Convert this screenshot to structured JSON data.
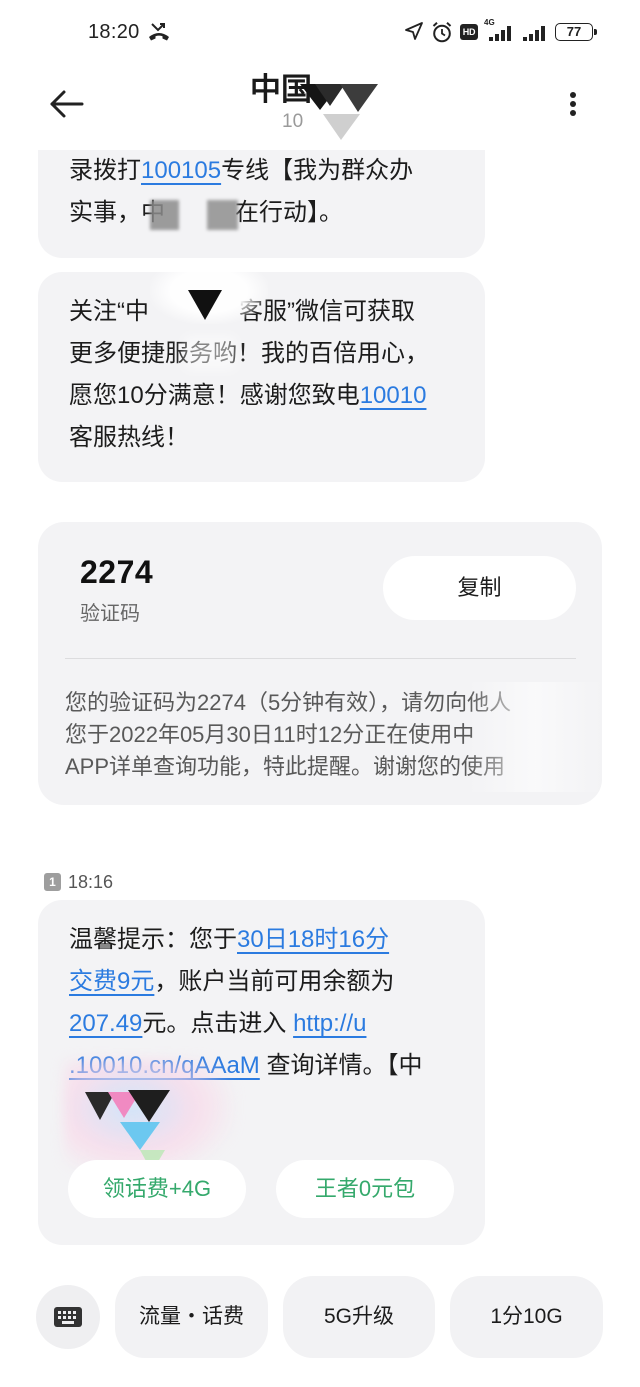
{
  "colors": {
    "link": "#2b7be0",
    "action_green": "#35a96c",
    "bubble_bg": "#f3f3f5",
    "text": "#1c1c1c"
  },
  "status_bar": {
    "time": "18:20",
    "hd_label": "HD",
    "network_label": "4G",
    "battery_level": "77",
    "icons": [
      "missed-call-icon",
      "location-arrow-icon",
      "alarm-clock-icon",
      "signal-icon",
      "battery-icon"
    ]
  },
  "header": {
    "title": "中国",
    "subtitle": "10",
    "back_icon": "back-arrow-icon",
    "menu_icon": "more-vertical-icon"
  },
  "messages": [
    {
      "lines": [
        [
          "录拨打",
          "100105",
          "专线【我为群众办"
        ],
        [
          "实事，中",
          "在行动】。"
        ]
      ]
    },
    {
      "lines": [
        [
          "关注“中",
          "客服”微信可获取"
        ],
        [
          "更多便捷服务哟！我的百倍用心，"
        ],
        [
          "愿您10分满意！感谢您致电",
          "10010"
        ],
        [
          "客服热线！"
        ]
      ]
    },
    {
      "type": "verification_code",
      "code": "2274",
      "code_label": "验证码",
      "copy_label": "复制",
      "body_lines": [
        "您的验证码为2274（5分钟有效），请勿向他人",
        "您于2022年05月30日11时12分正在使用中",
        "APP详单查询功能，特此提醒。谢谢您的使用"
      ]
    },
    {
      "timestamp": {
        "sim_slot": "1",
        "time": "18:16"
      },
      "lines": [
        [
          "温馨提示：您于",
          "30日18时16分"
        ],
        [
          "交费9元",
          "，账户当前可用余额为"
        ],
        [
          "207.49",
          "元。点击进入 ",
          "http://u"
        ],
        [
          ".10010.cn/qAAaM",
          " 查询详情。【中"
        ]
      ],
      "actions": [
        "领话费+4G",
        "王者0元包"
      ]
    }
  ],
  "quick_replies": {
    "keyboard_icon": "keyboard-icon",
    "chips": [
      "流量・话费",
      "5G升级",
      "1分10G"
    ]
  }
}
